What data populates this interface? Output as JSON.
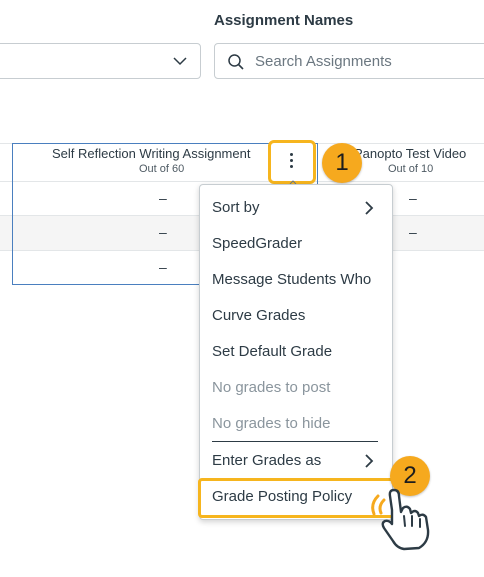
{
  "filters": {
    "section_title": "Assignment Names",
    "search_placeholder": "Search Assignments"
  },
  "gradebook": {
    "columns": [
      {
        "title": "Self Reflection Writing Assignment",
        "subtitle": "Out of 60"
      },
      {
        "title": "Panopto Test Video",
        "subtitle": "Out of 10"
      }
    ],
    "rows": [
      {
        "col1": "–",
        "col2": "–"
      },
      {
        "col1": "–",
        "col2": "–"
      },
      {
        "col1": "–"
      }
    ]
  },
  "callouts": {
    "step1": "1",
    "step2": "2"
  },
  "column_menu": {
    "items": [
      {
        "label": "Sort by",
        "submenu": true,
        "disabled": false
      },
      {
        "label": "SpeedGrader",
        "disabled": false
      },
      {
        "label": "Message Students Who",
        "disabled": false
      },
      {
        "label": "Curve Grades",
        "disabled": false
      },
      {
        "label": "Set Default Grade",
        "disabled": false
      },
      {
        "label": "No grades to post",
        "disabled": true
      },
      {
        "label": "No grades to hide",
        "disabled": true
      },
      {
        "label": "Enter Grades as",
        "submenu": true,
        "disabled": false
      },
      {
        "label": "Grade Posting Policy",
        "disabled": false
      }
    ]
  },
  "colors": {
    "accent_highlight": "#f6b51e",
    "badge": "#f6a91e",
    "grid_outline": "#4a7fbf",
    "text": "#2d3b45"
  },
  "icons": [
    "chevron-down-icon",
    "search-icon",
    "kebab-menu-icon",
    "chevron-right-icon",
    "pointer-hand-icon"
  ]
}
